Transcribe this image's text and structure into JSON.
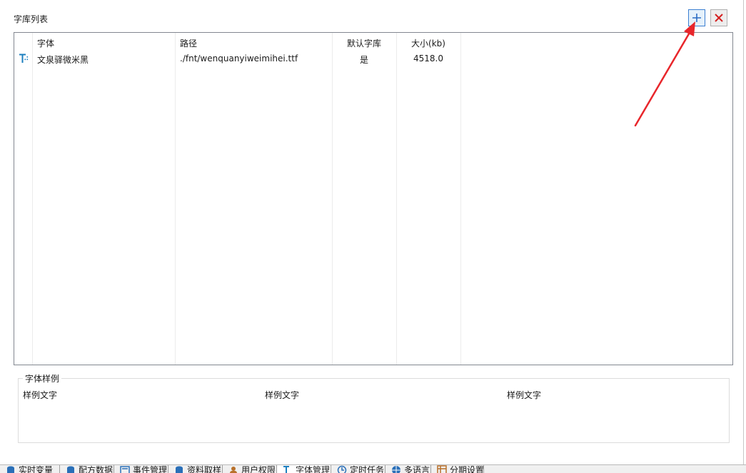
{
  "section_title": "字库列表",
  "toolbar": {
    "add_icon": "plus-icon",
    "delete_icon": "close-x-icon"
  },
  "table": {
    "columns": [
      "字体",
      "路径",
      "默认字库",
      "大小(kb)"
    ],
    "rows": [
      {
        "icon": "font-icon",
        "font": "文泉驿微米黑",
        "path": "./fnt/wenquanyiweimihei.ttf",
        "default": "是",
        "size": "4518.0"
      }
    ]
  },
  "sample_group": {
    "legend": "字体样例",
    "samples": [
      "样例文字",
      "样例文字",
      "样例文字"
    ]
  },
  "tabs": [
    {
      "label": "实时变量",
      "icon": "database-icon",
      "active": false
    },
    {
      "label": "配方数据",
      "icon": "database-icon",
      "active": false
    },
    {
      "label": "事件管理",
      "icon": "list-icon",
      "active": false
    },
    {
      "label": "资料取样",
      "icon": "database-icon",
      "active": false
    },
    {
      "label": "用户权限",
      "icon": "users-icon",
      "active": false
    },
    {
      "label": "字体管理",
      "icon": "font-icon",
      "active": true
    },
    {
      "label": "定时任务",
      "icon": "clock-icon",
      "active": false
    },
    {
      "label": "多语言",
      "icon": "globe-icon",
      "active": false
    },
    {
      "label": "分期设置",
      "icon": "grid-icon",
      "active": false
    }
  ],
  "colors": {
    "accent": "#3c7fd1",
    "delete": "#d42020",
    "annotation_arrow": "#e8262b"
  }
}
